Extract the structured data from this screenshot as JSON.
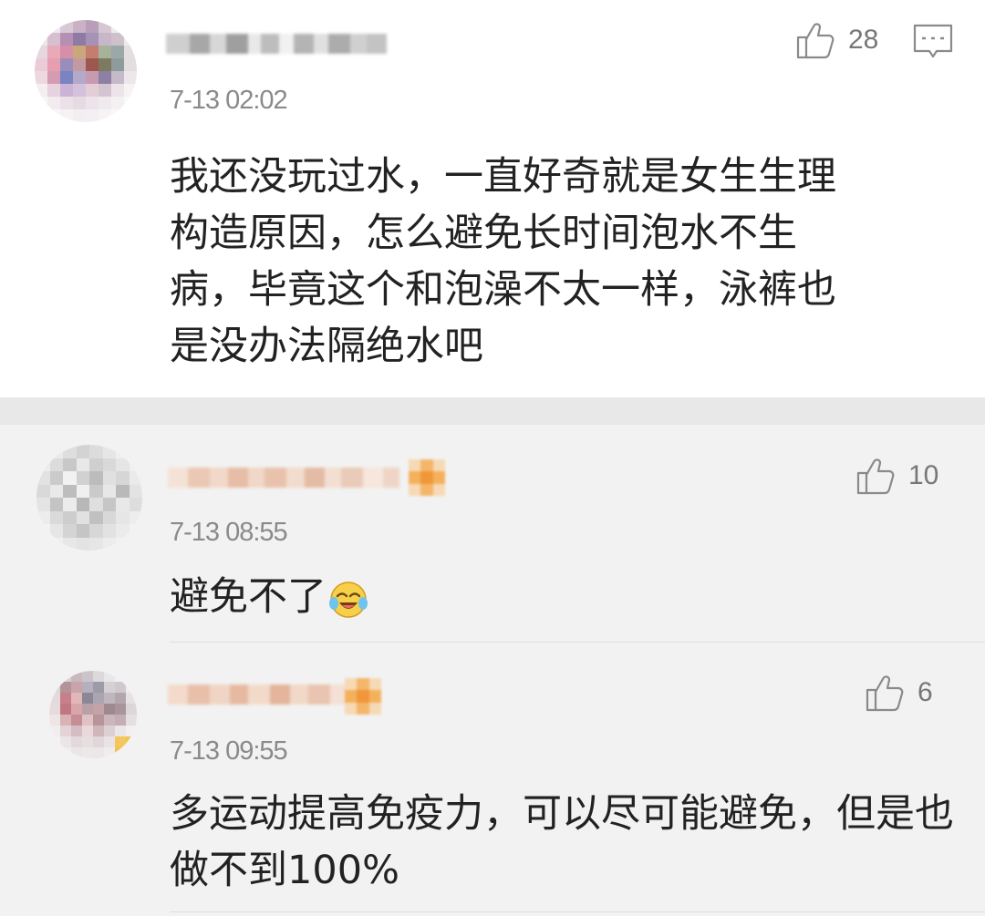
{
  "main": {
    "timestamp": "7-13 02:02",
    "likes": "28",
    "text_lines": [
      "我还没玩过水，一直好奇就是女生生理",
      "构造原因，怎么避免长时间泡水不生",
      "病，毕竟这个和泡澡不太一样，泳裤也",
      "是没办法隔绝水吧"
    ],
    "icons": {
      "like": "thumbs-up-icon",
      "reply": "comment-icon"
    }
  },
  "replies": [
    {
      "timestamp": "7-13 08:55",
      "likes": "10",
      "text": "避免不了",
      "emoji": "laugh-cry-emoji"
    },
    {
      "timestamp": "7-13 09:55",
      "likes": "6",
      "text_lines": [
        "多运动提高免疫力，可以尽可能避免，但是也",
        "做不到100%"
      ]
    }
  ],
  "colors": {
    "background_main": "#ffffff",
    "background_replies": "#f2f2f2",
    "divider": "#e8e8e8",
    "text": "#222222",
    "meta": "#8a8a8a",
    "badge": "#f3a847"
  }
}
